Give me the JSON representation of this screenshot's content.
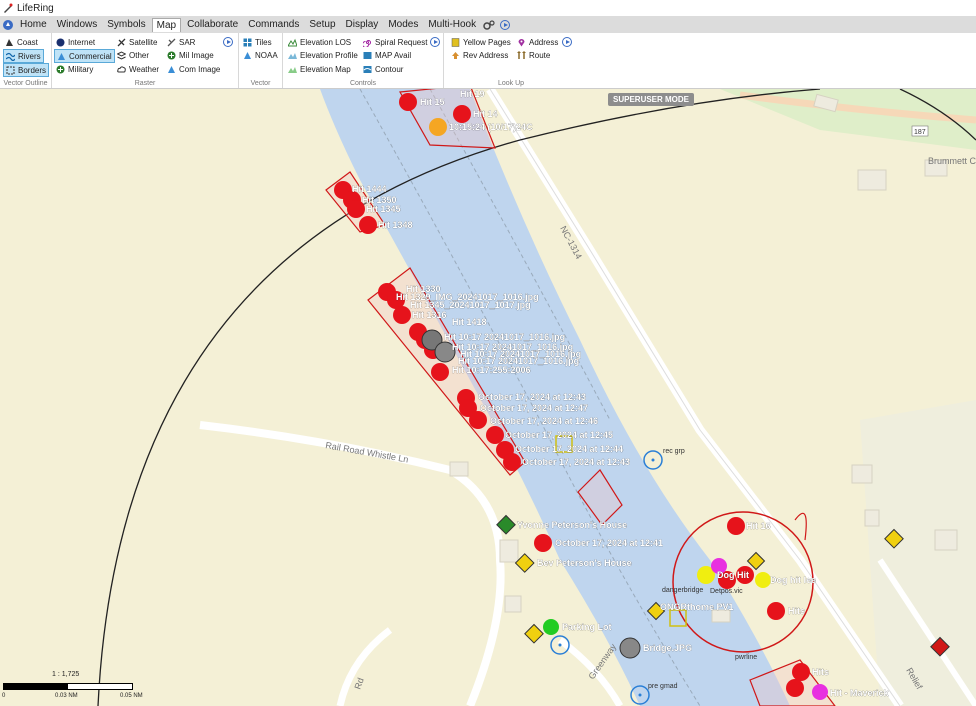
{
  "window": {
    "title": "LifeRing"
  },
  "menu": {
    "items": [
      "Home",
      "Windows",
      "Symbols",
      "Map",
      "Collaborate",
      "Commands",
      "Setup",
      "Display",
      "Modes",
      "Multi-Hook"
    ],
    "active": "Map"
  },
  "ribbon": {
    "vector_outline": {
      "label": "Vector Outline",
      "coast": "Coast",
      "rivers": "Rivers",
      "borders": "Borders"
    },
    "raster": {
      "label": "Raster",
      "internet": "Internet",
      "commercial": "Commercial",
      "military": "Military",
      "satellite": "Satellite",
      "other": "Other",
      "weather": "Weather",
      "sar": "SAR",
      "mil_image": "Mil Image",
      "com_image": "Com Image"
    },
    "vector": {
      "label": "Vector",
      "tiles": "Tiles",
      "noaa": "NOAA"
    },
    "controls": {
      "label": "Controls",
      "elevation_los": "Elevation LOS",
      "elevation_profile": "Elevation Profile",
      "elevation_map": "Elevation Map",
      "spiral_request": "Spiral Request",
      "map_avail": "MAP Avail",
      "contour": "Contour"
    },
    "look_up": {
      "label": "Look Up",
      "yellow_pages": "Yellow Pages",
      "rev_address": "Rev Address",
      "address": "Address",
      "route": "Route"
    }
  },
  "map": {
    "mode_badge": "SUPERUSER MODE",
    "roads": {
      "nc1314": "NC-1314",
      "railroad": "Rail Road Whistle Ln",
      "greenway": "Greenway",
      "rd": "Rd",
      "reliefs": "Relief",
      "road_187": "187",
      "brummett": "Brummett C"
    },
    "labels": {
      "hit15": "Hit 15",
      "hit19": "Hit 19",
      "hit14": "Hit 14",
      "time_2424": "10:15:24 (10/17)24C",
      "hit1444": "Hit 1444",
      "hit1350": "Hit 1350",
      "hit1345": "Hit 1345",
      "hit1348": "Hit 1348",
      "hit1330": "Hit 1330",
      "img_1329": "Hit 1329_IMG_20241017_1016.jpg",
      "img_1345": "Hit 1345_20241017_1017.jpg",
      "hit1316": "Hit 1316",
      "hit1418": "Hit 1418",
      "img_a": "Hit 10:17 20241017_1016.jpg",
      "img_b": "Hit 10:17 20241017_1016.jpg",
      "img_c": "Hit 10:17 20241017_1016.jpg",
      "img_d": "Hit 10:17 20241017_1016.jpg",
      "hit10": "Hit 10:17:255:2006",
      "oct_1243": "October 17, 2024 at 12:43",
      "oct_1247": "October 17, 2024 at 12:47",
      "oct_1246": "October 17, 2024 at 12:46",
      "oct_1245": "October 17, 2024 at 12:45",
      "oct_1244": "October 17, 2024 at 12:44",
      "oct_1243b": "October 17, 2024 at 12:43",
      "oct_1241": "October 17, 2024 at 12:41",
      "rec_grp": "rec grp",
      "yvonne": "Yvonne Peterson's House",
      "bev": "Bev Peterson's House",
      "parking": "Parking Lot",
      "bridge": "Bridge.JPG",
      "hit16": "Hit 16",
      "dog_hit": "Dog Hit",
      "dog_hit_b": "Dog hit lee",
      "hits": "Hits",
      "maverick": "Hit - Maverick",
      "danger": "dangerbridge",
      "detpos": "Detpos.vic",
      "ongr": "ONGRthome PV1",
      "powerline": "pwrline",
      "pre_gmad": "pre gmad",
      "hit_s": "Hits"
    }
  },
  "scale": {
    "ratio": "1 : 1,725",
    "t0": "0",
    "t1": "0.03 NM",
    "t2": "0.05 NM"
  }
}
